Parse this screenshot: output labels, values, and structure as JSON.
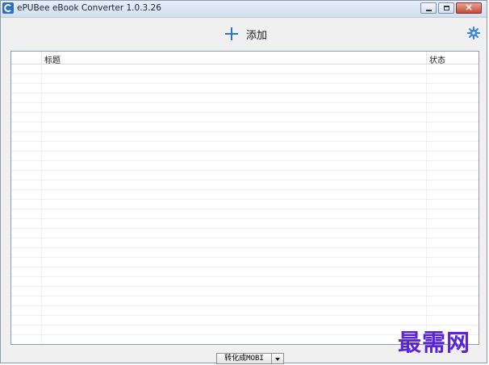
{
  "window": {
    "title": "ePUBee eBook Converter 1.0.3.26"
  },
  "toolbar": {
    "add_label": "添加"
  },
  "table": {
    "columns": [
      "标题",
      "状态"
    ],
    "rows": []
  },
  "footer": {
    "convert_label": "转化成MOBI"
  },
  "watermark": {
    "text": "最需网"
  },
  "icons": {
    "app": "app-logo-icon",
    "add": "plus-icon",
    "settings": "gear-icon",
    "dropdown": "chevron-down-icon"
  },
  "colors": {
    "accent": "#2c76c8",
    "watermark": "#5a24d6"
  }
}
